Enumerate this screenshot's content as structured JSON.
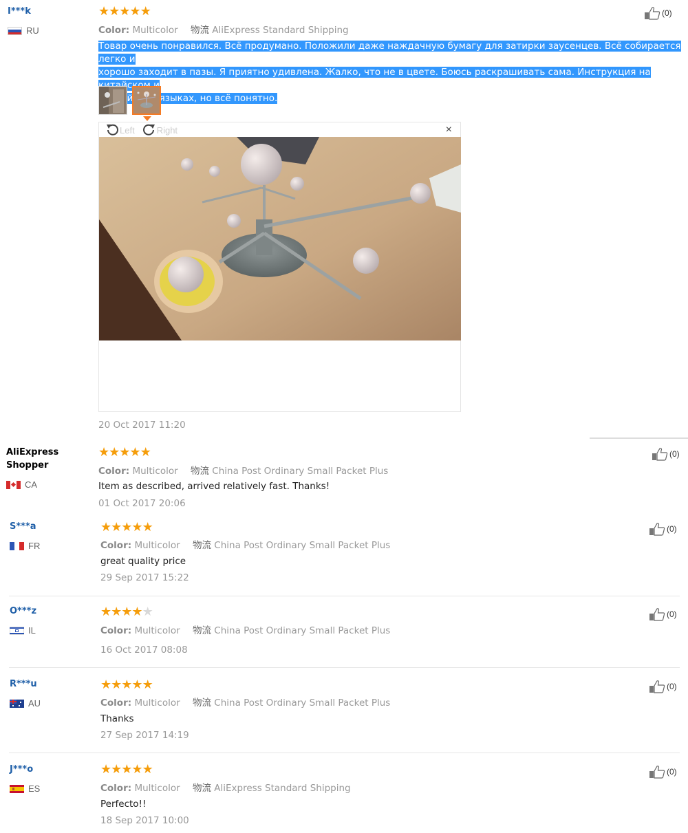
{
  "labels": {
    "color": "Color:",
    "ship_prefix": "物流"
  },
  "reviews": [
    {
      "author": "I***k",
      "country": "RU",
      "rating": 5,
      "color": "Multicolor",
      "shipping": "AliExpress Standard Shipping",
      "text": "Товар очень понравился. Всё продумано. Положили даже наждачную бумагу для затирки заусенцев. Всё собирается легко и хорошо заходит в пазы. Я приятно удивлена. Жалко, что не в цвете. Боюсь раскрашивать сама. Инструкция на китайском и английском языках, но всё понятно.",
      "text_lines": [
        "Товар очень понравился. Всё продумано. Положили даже наждачную бумагу для затирки заусенцев. Всё собирается легко и",
        "хорошо заходит в пазы. Я приятно удивлена. Жалко, что не в цвете. Боюсь раскрашивать сама. Инструкция на китайском и",
        "английском языках, но всё понятно."
      ],
      "date": "20 Oct 2017 11:20",
      "helpful": "(0)"
    },
    {
      "author": "AliExpress Shopper",
      "author_lines": [
        "AliExpress",
        "Shopper"
      ],
      "country": "CA",
      "rating": 5,
      "color": "Multicolor",
      "shipping": "China Post Ordinary Small Packet Plus",
      "text": "Item as described, arrived relatively fast. Thanks!",
      "date": "01 Oct 2017 20:06",
      "helpful": "(0)"
    },
    {
      "author": "S***a",
      "country": "FR",
      "rating": 5,
      "color": "Multicolor",
      "shipping": "China Post Ordinary Small Packet Plus",
      "text": "great quality price",
      "date": "29 Sep 2017 15:22",
      "helpful": "(0)"
    },
    {
      "author": "O***z",
      "country": "IL",
      "rating": 4,
      "color": "Multicolor",
      "shipping": "China Post Ordinary Small Packet Plus",
      "text": "",
      "date": "16 Oct 2017 08:08",
      "helpful": "(0)"
    },
    {
      "author": "R***u",
      "country": "AU",
      "rating": 5,
      "color": "Multicolor",
      "shipping": "China Post Ordinary Small Packet Plus",
      "text": "Thanks",
      "date": "27 Sep 2017 14:19",
      "helpful": "(0)"
    },
    {
      "author": "J***o",
      "country": "ES",
      "rating": 5,
      "color": "Multicolor",
      "shipping": "AliExpress Standard Shipping",
      "text": "Perfecto!!",
      "date": "18 Sep 2017 10:00",
      "helpful": "(0)"
    }
  ],
  "viewer": {
    "rotate_left": "Left",
    "rotate_right": "Right",
    "close": "×",
    "thumb_count": 2,
    "active_thumb": 2
  },
  "colors": {
    "star": "#f59d0b",
    "author": "#1f5fa8",
    "selection": "#3297fd",
    "active_thumb": "#f57b24"
  }
}
